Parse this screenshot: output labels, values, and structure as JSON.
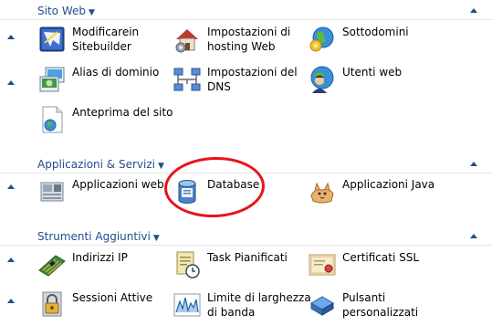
{
  "sections": [
    {
      "title": "Sito Web",
      "items": [
        {
          "lines": [
            "Modificarein",
            "Sitebuilder"
          ],
          "icon": "sitebuilder-icon"
        },
        {
          "lines": [
            "Impostazioni di",
            "hosting Web"
          ],
          "icon": "house-settings-icon"
        },
        {
          "lines": [
            "Sottodomini"
          ],
          "icon": "globe-icon"
        },
        {
          "lines": [
            "Alias di dominio"
          ],
          "icon": "domain-alias-icon"
        },
        {
          "lines": [
            "Impostazioni del",
            "DNS"
          ],
          "icon": "dns-network-icon"
        },
        {
          "lines": [
            "Utenti web"
          ],
          "icon": "web-users-icon"
        },
        {
          "lines": [
            "Anteprima del sito"
          ],
          "icon": "site-preview-icon"
        }
      ]
    },
    {
      "title": "Applicazioni & Servizi",
      "items": [
        {
          "lines": [
            "Applicazioni web"
          ],
          "icon": "web-applications-icon"
        },
        {
          "lines": [
            "Database"
          ],
          "icon": "database-icon"
        },
        {
          "lines": [
            "Applicazioni Java"
          ],
          "icon": "java-tomcat-icon"
        }
      ]
    },
    {
      "title": "Strumenti Aggiuntivi",
      "items": [
        {
          "lines": [
            "Indirizzi IP"
          ],
          "icon": "ip-card-icon"
        },
        {
          "lines": [
            "Task Pianificati"
          ],
          "icon": "scheduled-tasks-icon"
        },
        {
          "lines": [
            "Certificati SSL"
          ],
          "icon": "ssl-certificate-icon"
        },
        {
          "lines": [
            "Sessioni Attive"
          ],
          "icon": "active-sessions-icon"
        },
        {
          "lines": [
            "Limite di larghezza",
            "di banda"
          ],
          "icon": "bandwidth-chart-icon"
        },
        {
          "lines": [
            "Pulsanti",
            "personalizzati"
          ],
          "icon": "custom-buttons-icon"
        }
      ]
    }
  ],
  "colors": {
    "section_title": "#1f4e8c",
    "highlight_circle": "#e8141b"
  }
}
